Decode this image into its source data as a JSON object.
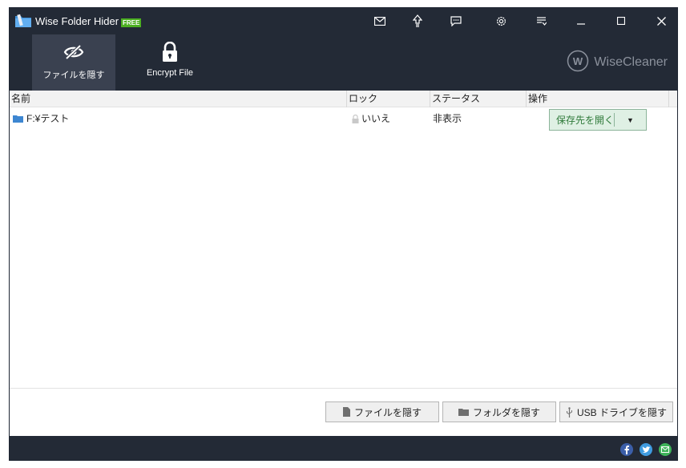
{
  "app": {
    "title": "Wise Folder Hider",
    "badge": "FREE"
  },
  "titlebar_icons": [
    "mail-icon",
    "upgrade-icon",
    "feedback-icon",
    "settings-icon",
    "menu-icon"
  ],
  "window_controls": [
    "minimize",
    "maximize",
    "close"
  ],
  "nav": {
    "tabs": [
      {
        "label": "ファイルを隠す",
        "icon": "eye-slash-icon",
        "active": true
      },
      {
        "label": "Encrypt File",
        "icon": "lock-icon",
        "active": false
      }
    ]
  },
  "brand": {
    "text": "WiseCleaner",
    "logo_letter": "W"
  },
  "table": {
    "headers": [
      "名前",
      "ロック",
      "ステータス",
      "操作"
    ],
    "rows": [
      {
        "name": "F:¥テスト",
        "lock": "いいえ",
        "status": "非表示",
        "action_label": "保存先を開く",
        "action_arrow": "▼"
      }
    ]
  },
  "actions": {
    "hide_file": "ファイルを隠す",
    "hide_folder": "フォルダを隠す",
    "hide_usb": "USB ドライブを隠す"
  },
  "colors": {
    "dark_bar": "#232a36",
    "active_tab": "#3a4150",
    "free_badge": "#4caf22",
    "open_button_bg": "#dff0e4",
    "open_button_text": "#2f7a3a"
  }
}
